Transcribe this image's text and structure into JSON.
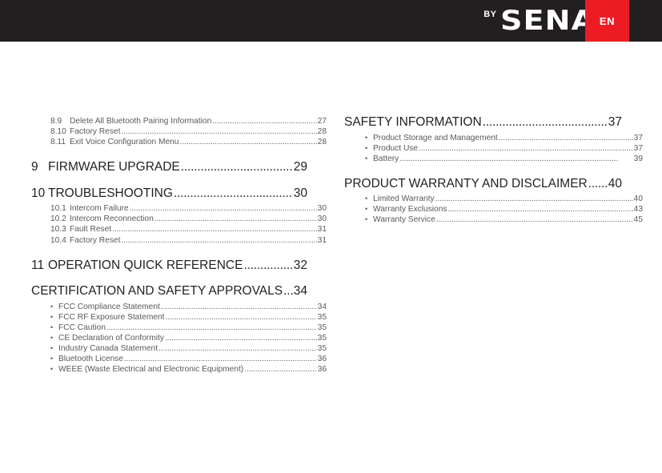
{
  "header": {
    "brand_by": "BY",
    "brand_name": "SENA",
    "language_badge": "EN",
    "bar_color": "#231f20",
    "badge_color": "#ed1c24"
  },
  "toc": {
    "left_column": [
      {
        "type": "sub-group",
        "entries": [
          {
            "num": "8.9",
            "label": "Delete All Bluetooth Pairing Information",
            "page": "27"
          },
          {
            "num": "8.10",
            "label": "Factory Reset ",
            "page": "28"
          },
          {
            "num": "8.11",
            "label": "Exit Voice Configuration Menu",
            "page": "28"
          }
        ]
      },
      {
        "type": "section",
        "heading": {
          "num": "9",
          "label": "FIRMWARE UPGRADE",
          "page": "29"
        },
        "entries": []
      },
      {
        "type": "section",
        "heading": {
          "num": "10",
          "label": "TROUBLESHOOTING ",
          "page": "30"
        },
        "entries": [
          {
            "num": "10.1",
            "label": "Intercom Failure",
            "page": "30"
          },
          {
            "num": "10.2",
            "label": "Intercom Reconnection",
            "page": "30"
          },
          {
            "num": "10.3",
            "label": "Fault Reset",
            "page": "31"
          },
          {
            "num": "10.4",
            "label": "Factory Reset ",
            "page": "31"
          }
        ]
      },
      {
        "type": "section",
        "heading": {
          "num": "11",
          "label": "OPERATION QUICK REFERENCE ",
          "page": "32"
        },
        "entries": []
      },
      {
        "type": "section-nonumber",
        "heading": {
          "num": "",
          "label": "CERTIFICATION AND SAFETY APPROVALS",
          "page": "34"
        },
        "bullets": [
          {
            "label": "FCC Compliance Statement",
            "page": "34"
          },
          {
            "label": "FCC RF Exposure Statement",
            "page": "35"
          },
          {
            "label": "FCC Caution ",
            "page": "35"
          },
          {
            "label": "CE Declaration of Conformity ",
            "page": "35"
          },
          {
            "label": "Industry Canada Statement ",
            "page": "35"
          },
          {
            "label": "Bluetooth License ",
            "page": "36"
          },
          {
            "label": "WEEE (Waste Electrical and Electronic Equipment)",
            "page": "36"
          }
        ]
      }
    ],
    "right_column": [
      {
        "type": "section-nonumber",
        "heading": {
          "num": "",
          "label": "SAFETY INFORMATION ",
          "page": "37"
        },
        "bullets": [
          {
            "label": "Product Storage and Management",
            "page": "37"
          },
          {
            "label": "Product Use ",
            "page": "37"
          },
          {
            "label": "Battery",
            "page": "39"
          }
        ]
      },
      {
        "type": "section-nonumber",
        "heading": {
          "num": "",
          "label": "PRODUCT WARRANTY AND DISCLAIMER",
          "page": "40"
        },
        "bullets": [
          {
            "label": "Limited Warranty ",
            "page": "40"
          },
          {
            "label": "Warranty Exclusions ",
            "page": "43"
          },
          {
            "label": "Warranty Service",
            "page": "45"
          }
        ]
      }
    ]
  },
  "symbols": {
    "bullet": "•",
    "leader_dots": "...................................................................................................."
  }
}
